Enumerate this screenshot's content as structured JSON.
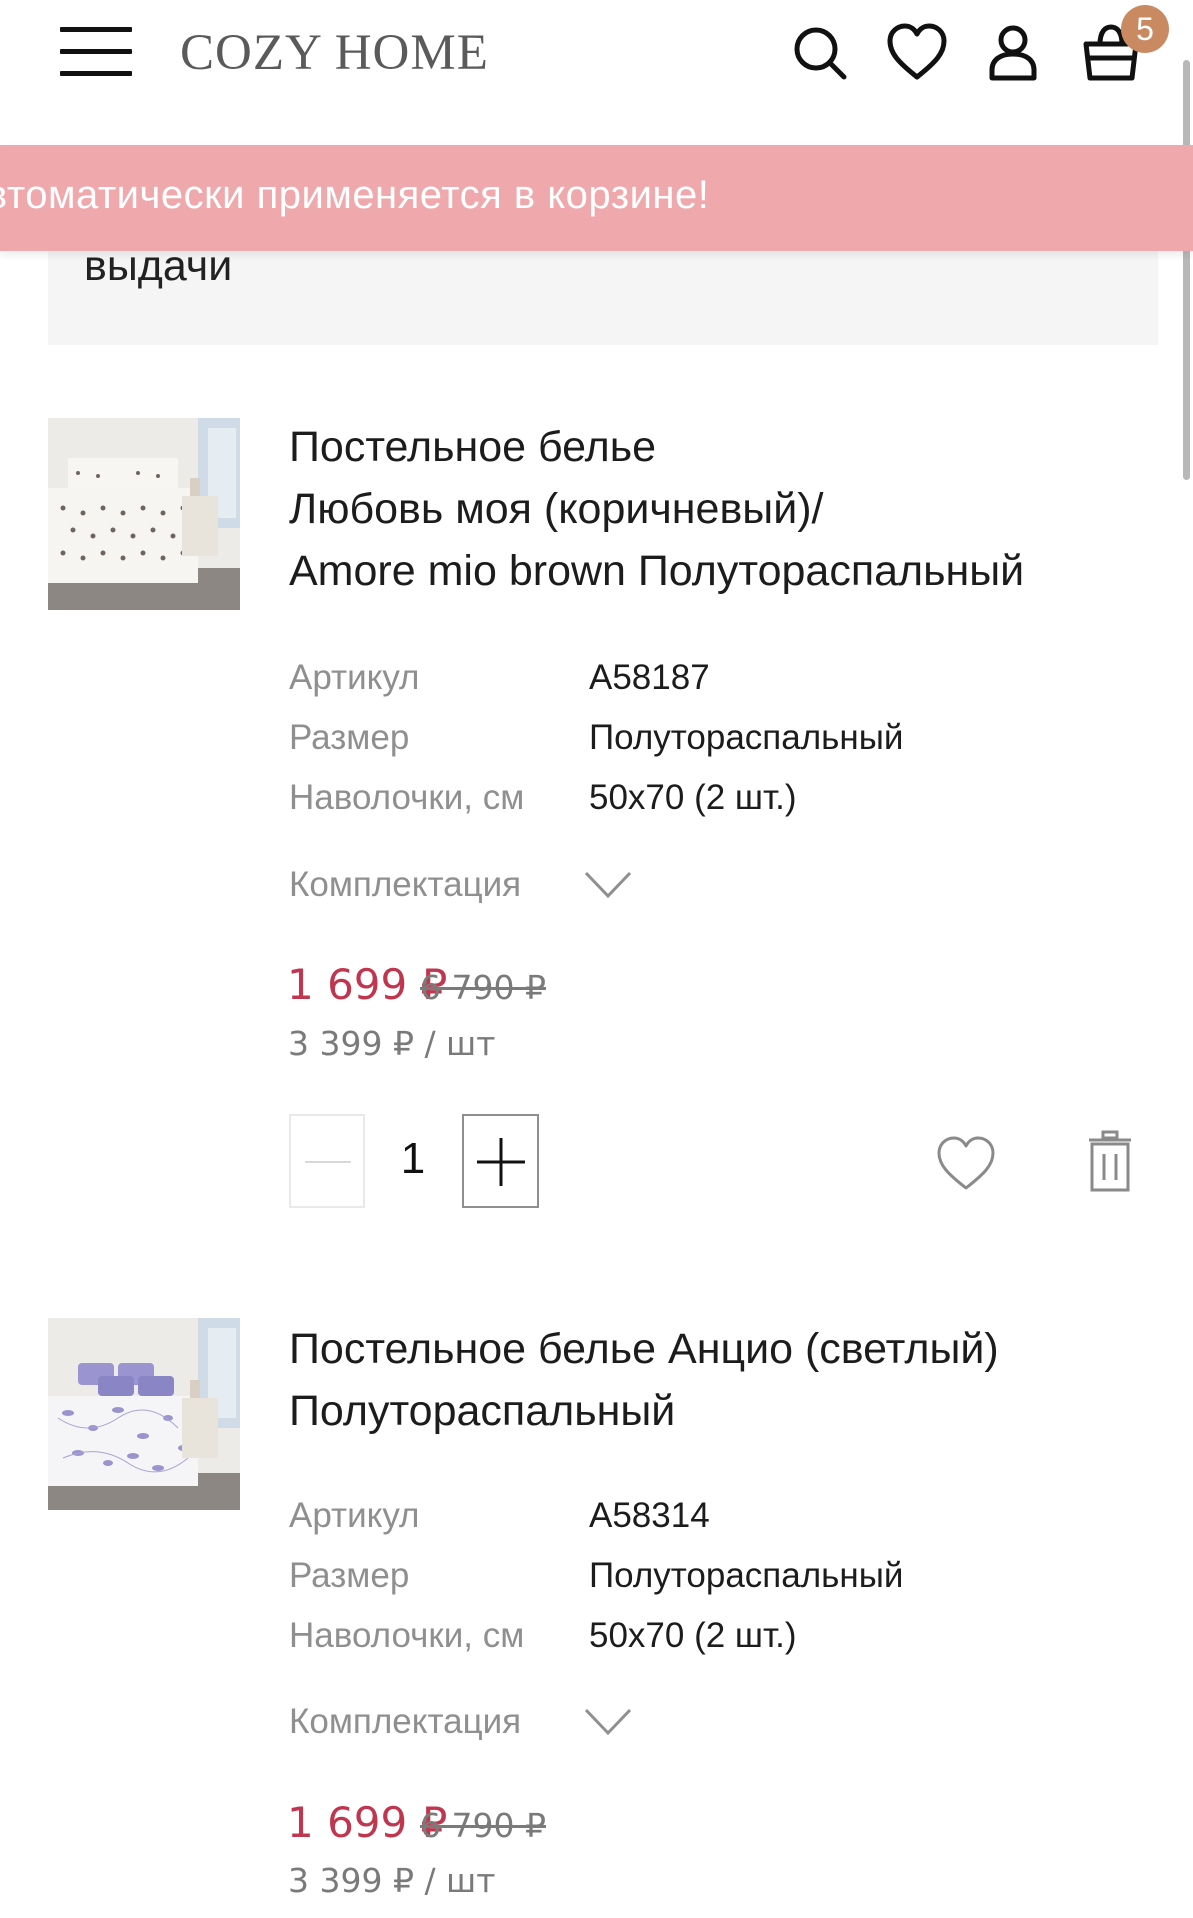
{
  "header": {
    "logo": "COZY HOME",
    "cart_count": "5",
    "icons": [
      "menu-icon",
      "search-icon",
      "heart-icon",
      "user-icon",
      "bag-icon"
    ]
  },
  "promo": {
    "text": "втоматически применяется в корзине!",
    "color": "#efa8ac"
  },
  "pickup": {
    "text": "выдачи"
  },
  "labels": {
    "article": "Артикул",
    "size": "Размер",
    "pillowcases": "Наволочки, см",
    "kit": "Комплектация"
  },
  "products": [
    {
      "title_lines": [
        "Постельное белье",
        "Любовь моя (коричневый)/",
        "Amore mio brown Полутораспальный"
      ],
      "article": "A58187",
      "size": "Полутораспальный",
      "pillowcases": "50x70 (2 шт.)",
      "price": "1 699 ₽",
      "old_price": "6 790 ₽",
      "unit_price": "3 399 ₽ / шт",
      "quantity": "1"
    },
    {
      "title_lines": [
        "Постельное белье Анцио (светлый)",
        "Полутораспальный"
      ],
      "article": "A58314",
      "size": "Полутораспальный",
      "pillowcases": "50x70 (2 шт.)",
      "price": "1 699 ₽",
      "old_price": "6 790 ₽",
      "unit_price": "3 399 ₽ / шт"
    }
  ],
  "colors": {
    "price": "#c0364f",
    "badge": "#c98a62"
  }
}
